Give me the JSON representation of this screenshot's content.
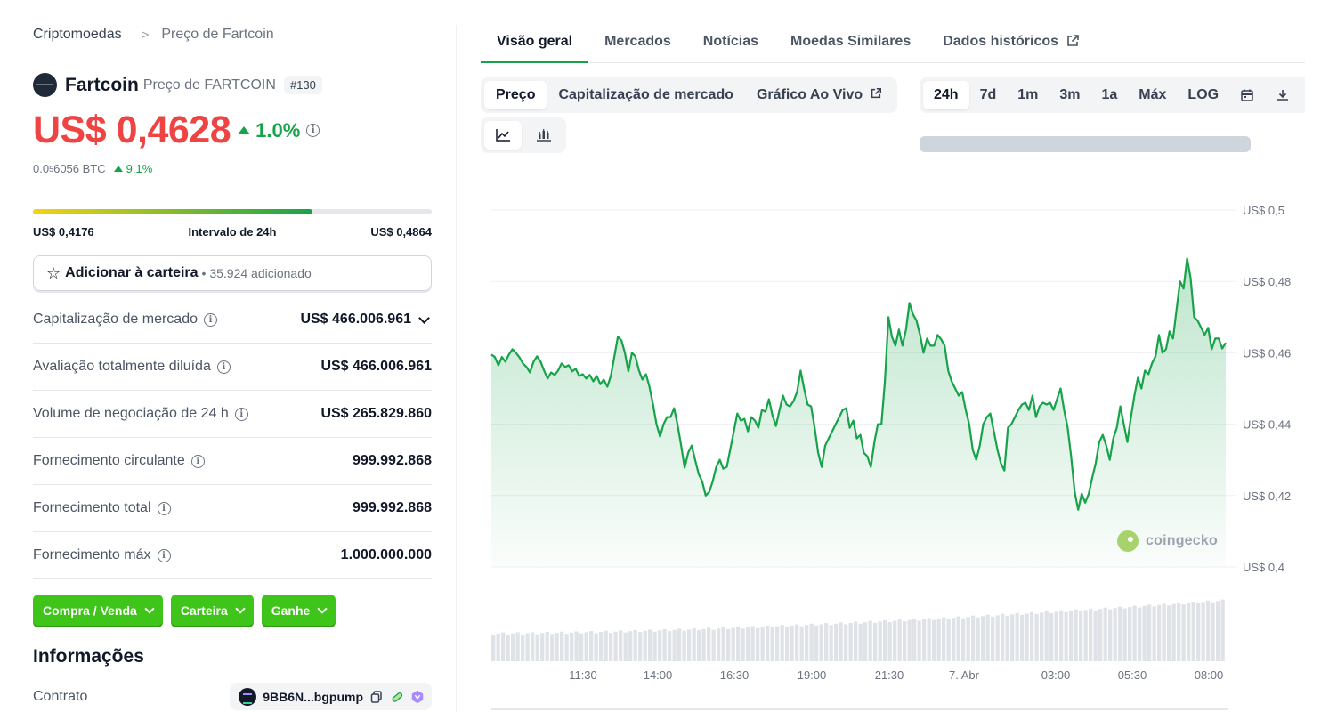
{
  "breadcrumb": {
    "root": "Criptomoedas",
    "separator": ">",
    "current": "Preço de Fartcoin"
  },
  "coin": {
    "name": "Fartcoin",
    "subtitle": "Preço de FARTCOIN",
    "rank": "#130"
  },
  "price": {
    "value": "US$ 0,4628",
    "change": "1.0%",
    "btc_prefix": "0.0",
    "btc_sub": "5",
    "btc_rest": "6056 BTC",
    "btc_change": "9.1%"
  },
  "range": {
    "low": "US$ 0,4176",
    "label": "Intervalo de 24h",
    "high": "US$ 0,4864",
    "position_pct": 70
  },
  "watchlist": {
    "label": "Adicionar à carteira",
    "count": "• 35.924 adicionado"
  },
  "stats": [
    {
      "label": "Capitalização de mercado",
      "value": "US$ 466.006.961"
    },
    {
      "label": "Avaliação totalmente diluída",
      "value": "US$ 466.006.961"
    },
    {
      "label": "Volume de negociação de 24 h",
      "value": "US$ 265.829.860"
    },
    {
      "label": "Fornecimento circulante",
      "value": "999.992.868"
    },
    {
      "label": "Fornecimento total",
      "value": "999.992.868"
    },
    {
      "label": "Fornecimento máx",
      "value": "1.000.000.000"
    }
  ],
  "actions": {
    "buy_sell": "Compra / Venda",
    "wallet": "Carteira",
    "earn": "Ganhe"
  },
  "info": {
    "title": "Informações",
    "contract_label": "Contrato",
    "contract_value": "9BB6N...bgpump"
  },
  "tabs": [
    "Visão geral",
    "Mercados",
    "Notícias",
    "Moedas Similares",
    "Dados históricos"
  ],
  "chart_tabs": [
    "Preço",
    "Capitalização de mercado",
    "Gráfico Ao Vivo"
  ],
  "ranges": [
    "24h",
    "7d",
    "1m",
    "3m",
    "1a",
    "Máx",
    "LOG"
  ],
  "watermark": "coingecko",
  "colors": {
    "accent_green": "#16a34a",
    "price_red": "#ef4444",
    "button_green": "#3fc51a"
  },
  "icons": [
    "star-icon",
    "info-icon",
    "chevron-down-icon",
    "external-link-icon",
    "line-chart-icon",
    "candlestick-icon",
    "calendar-icon",
    "download-icon",
    "copy-icon",
    "link-icon",
    "metamask-icon"
  ],
  "chart_data": {
    "type": "line",
    "series": [
      {
        "values": [
          0.4595,
          0.4588,
          0.4565,
          0.4588,
          0.4575,
          0.4595,
          0.461,
          0.46,
          0.4587,
          0.457,
          0.456,
          0.4545,
          0.4575,
          0.459,
          0.4575,
          0.455,
          0.4528,
          0.4545,
          0.4538,
          0.455,
          0.457,
          0.456,
          0.4565,
          0.4548,
          0.4555,
          0.4535,
          0.454,
          0.4528,
          0.4538,
          0.452,
          0.4535,
          0.4512,
          0.4525,
          0.4505,
          0.4535,
          0.459,
          0.4645,
          0.4635,
          0.46,
          0.4548,
          0.46,
          0.459,
          0.455,
          0.4525,
          0.454,
          0.4505,
          0.4455,
          0.44,
          0.4365,
          0.44,
          0.442,
          0.442,
          0.4445,
          0.4398,
          0.434,
          0.4278,
          0.432,
          0.434,
          0.43,
          0.426,
          0.424,
          0.42,
          0.421,
          0.424,
          0.428,
          0.43,
          0.4275,
          0.428,
          0.433,
          0.438,
          0.443,
          0.441,
          0.4415,
          0.438,
          0.442,
          0.441,
          0.439,
          0.444,
          0.4435,
          0.447,
          0.4425,
          0.4395,
          0.444,
          0.448,
          0.4455,
          0.445,
          0.4465,
          0.449,
          0.455,
          0.45,
          0.4455,
          0.445,
          0.439,
          0.432,
          0.428,
          0.434,
          0.436,
          0.438,
          0.44,
          0.442,
          0.444,
          0.4445,
          0.439,
          0.441,
          0.436,
          0.437,
          0.432,
          0.431,
          0.428,
          0.435,
          0.44,
          0.44,
          0.452,
          0.47,
          0.4645,
          0.462,
          0.4665,
          0.462,
          0.4665,
          0.474,
          0.4708,
          0.469,
          0.465,
          0.46,
          0.464,
          0.462,
          0.462,
          0.465,
          0.4638,
          0.462,
          0.455,
          0.452,
          0.45,
          0.448,
          0.449,
          0.444,
          0.44,
          0.4328,
          0.43,
          0.434,
          0.44,
          0.442,
          0.443,
          0.438,
          0.433,
          0.429,
          0.427,
          0.439,
          0.44,
          0.442,
          0.444,
          0.4455,
          0.446,
          0.444,
          0.448,
          0.442,
          0.445,
          0.446,
          0.4455,
          0.446,
          0.444,
          0.447,
          0.45,
          0.444,
          0.439,
          0.431,
          0.421,
          0.416,
          0.4205,
          0.418,
          0.4205,
          0.425,
          0.429,
          0.435,
          0.437,
          0.434,
          0.43,
          0.436,
          0.439,
          0.445,
          0.44,
          0.435,
          0.4418,
          0.448,
          0.453,
          0.45,
          0.455,
          0.454,
          0.457,
          0.459,
          0.465,
          0.46,
          0.461,
          0.466,
          0.464,
          0.472,
          0.48,
          0.478,
          0.4864,
          0.481,
          0.47,
          0.469,
          0.467,
          0.465,
          0.467,
          0.461,
          0.464,
          0.464,
          0.4612,
          0.4628
        ]
      }
    ],
    "y_ticks": [
      "US$ 0,4",
      "US$ 0,42",
      "US$ 0,44",
      "US$ 0,46",
      "US$ 0,48",
      "US$ 0,5"
    ],
    "x_ticks": [
      "11:30",
      "14:00",
      "16:30",
      "19:00",
      "21:30",
      "7. Abr",
      "03:00",
      "05:30",
      "08:00"
    ],
    "ylim": [
      0.4,
      0.5
    ],
    "volume": "rising, small bars"
  }
}
